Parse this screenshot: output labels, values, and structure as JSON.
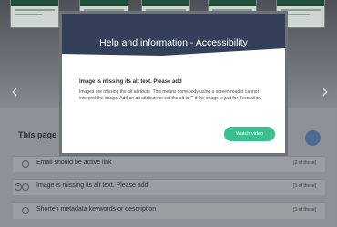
{
  "modal": {
    "title": "Help and information - Accessibility",
    "subtitle": "Image is missing its alt text. Please add",
    "description": "Images are missing the alt attribute. This means somebody using a screen reader cannot interpret the image. Add an alt attribute or set the alt to \"\" if the image is just for decoration.",
    "watch_label": "Watch video"
  },
  "nav": {
    "prev_glyph": "‹",
    "next_glyph": "›"
  },
  "panel": {
    "title": "This page l",
    "rows": [
      {
        "label": "Email should be active link",
        "count": "[2 of these]",
        "icon": "circle-icon"
      },
      {
        "label": "Image is missing its alt text. Please add",
        "count": "[1 of these]",
        "icon": "plus-circle-icon",
        "expander": "+"
      },
      {
        "label": "Shorten metadata keywords or description",
        "count": "[1 of these]",
        "icon": "circle-icon"
      }
    ]
  },
  "colors": {
    "modal_header": "#34405a",
    "accent_green": "#3bbf8f",
    "overlay": "#8d9096"
  }
}
